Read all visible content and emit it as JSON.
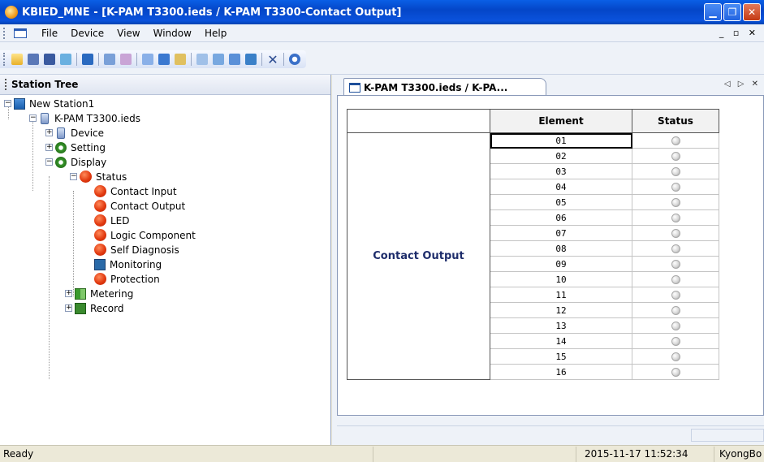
{
  "window": {
    "title": "KBIED_MNE - [K-PAM T3300.ieds / K-PAM T3300-Contact Output]",
    "controls": {
      "minimize": "▁",
      "restore": "❐",
      "close": "✕"
    }
  },
  "menubar": {
    "items": [
      {
        "label": "File"
      },
      {
        "label": "Device"
      },
      {
        "label": "View"
      },
      {
        "label": "Window"
      },
      {
        "label": "Help"
      }
    ],
    "mdi_controls": "_ ▫ ✕"
  },
  "toolbar": {
    "icons": [
      "open-folder-icon",
      "save-icon",
      "save-all-icon",
      "network-icon",
      "tree-icon",
      "download-icon",
      "upload-icon",
      "device-config-icon",
      "monitor-icon",
      "grid-icon",
      "window-icon",
      "connect-icon",
      "disconnect-icon",
      "send-icon",
      "delete-icon",
      "help-icon"
    ]
  },
  "tree_panel": {
    "title": "Station Tree",
    "nodes": [
      {
        "label": "New Station1"
      },
      {
        "label": "K-PAM T3300.ieds"
      },
      {
        "label": "Device"
      },
      {
        "label": "Setting"
      },
      {
        "label": "Display"
      },
      {
        "label": "Status"
      },
      {
        "label": "Contact Input"
      },
      {
        "label": "Contact Output"
      },
      {
        "label": "LED"
      },
      {
        "label": "Logic Component"
      },
      {
        "label": "Self Diagnosis"
      },
      {
        "label": "Monitoring"
      },
      {
        "label": "Protection"
      },
      {
        "label": "Metering"
      },
      {
        "label": "Record"
      }
    ]
  },
  "document": {
    "tab_label": "K-PAM T3300.ieds / K-PA...",
    "tab_nav": "◁ ▷ ✕",
    "table": {
      "columns": [
        "Element",
        "Status"
      ],
      "group_label": "Contact Output",
      "rows": [
        "01",
        "02",
        "03",
        "04",
        "05",
        "06",
        "07",
        "08",
        "09",
        "10",
        "11",
        "12",
        "13",
        "14",
        "15",
        "16"
      ]
    }
  },
  "statusbar": {
    "ready": "Ready",
    "datetime": "2015-11-17 11:52:34",
    "user": "KyongBo"
  }
}
